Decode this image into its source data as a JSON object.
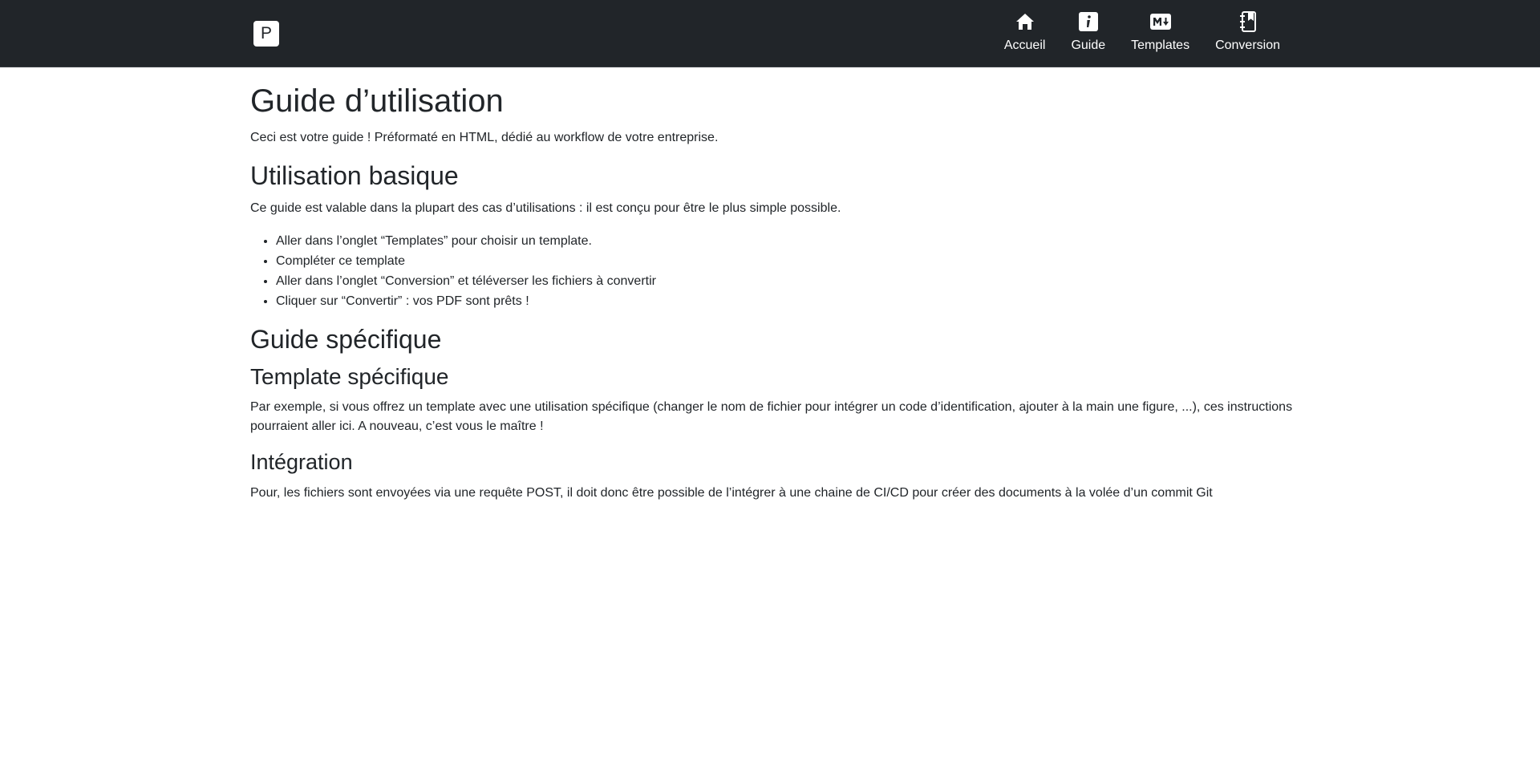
{
  "brand": {
    "letter": "P"
  },
  "nav": {
    "items": [
      {
        "label": "Accueil",
        "icon": "home-icon"
      },
      {
        "label": "Guide",
        "icon": "info-icon"
      },
      {
        "label": "Templates",
        "icon": "markdown-icon"
      },
      {
        "label": "Conversion",
        "icon": "notebook-icon"
      }
    ]
  },
  "page": {
    "title": "Guide d’utilisation",
    "intro": "Ceci est votre guide ! Préformaté en HTML, dédié au workflow de votre entreprise.",
    "basic": {
      "heading": "Utilisation basique",
      "text": "Ce guide est valable dans la plupart des cas d’utilisations : il est conçu pour être le plus simple possible.",
      "steps": [
        "Aller dans l’onglet “Templates” pour choisir un template.",
        "Compléter ce template",
        "Aller dans l’onglet “Conversion” et téléverser les fichiers à convertir",
        "Cliquer sur “Convertir” : vos PDF sont prêts !"
      ]
    },
    "specific": {
      "heading": "Guide spécifique",
      "template_heading": "Template spécifique",
      "template_text": "Par exemple, si vous offrez un template avec une utilisation spécifique (changer le nom de fichier pour intégrer un code d’identification, ajouter à la main une figure, ...), ces instructions pourraient aller ici. A nouveau, c’est vous le maître !",
      "integration_heading": "Intégration",
      "integration_text": "Pour, les fichiers sont envoyées via une requête POST, il doit donc être possible de l’intégrer à une chaine de CI/CD pour créer des documents à la volée d’un commit Git"
    }
  }
}
